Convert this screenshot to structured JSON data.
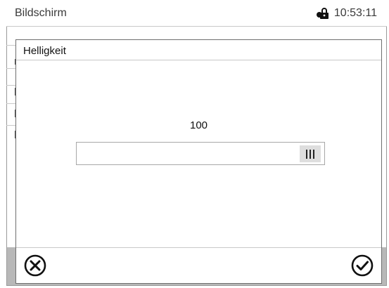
{
  "header": {
    "title": "Bildschirm",
    "lock_icon": "lock-icon",
    "time": "10:53:11"
  },
  "dialog": {
    "title": "Helligkeit",
    "value": "100",
    "slider_level_percent": 100,
    "cancel_icon": "cancel-circle-x-icon",
    "confirm_icon": "confirm-circle-check-icon"
  },
  "colors": {
    "bottom_strip": "#b8b8b8",
    "handle": "#dedede"
  }
}
